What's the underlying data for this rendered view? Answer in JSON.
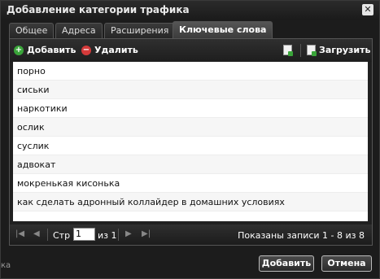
{
  "window": {
    "title": "Добавление категории трафика",
    "close_glyph": "✕"
  },
  "tabs": [
    {
      "label": "Общее"
    },
    {
      "label": "Адреса"
    },
    {
      "label": "Расширения"
    },
    {
      "label": "Ключевые слова",
      "active": true
    }
  ],
  "toolbar": {
    "add_label": "Добавить",
    "delete_label": "Удалить",
    "upload_label": "Загрузить"
  },
  "keywords": [
    "порно",
    "сиськи",
    "наркотики",
    "ослик",
    "суслик",
    "адвокат",
    "мокренькая кисонька",
    "как сделать адронный коллайдер в домашних условиях"
  ],
  "pager": {
    "page_label": "Стр",
    "page_value": "1",
    "of_label": "из 1",
    "status": "Показаны записи 1 - 8 из 8"
  },
  "footer": {
    "add_label": "Добавить",
    "cancel_label": "Отмена"
  },
  "stray_text": "ка"
}
